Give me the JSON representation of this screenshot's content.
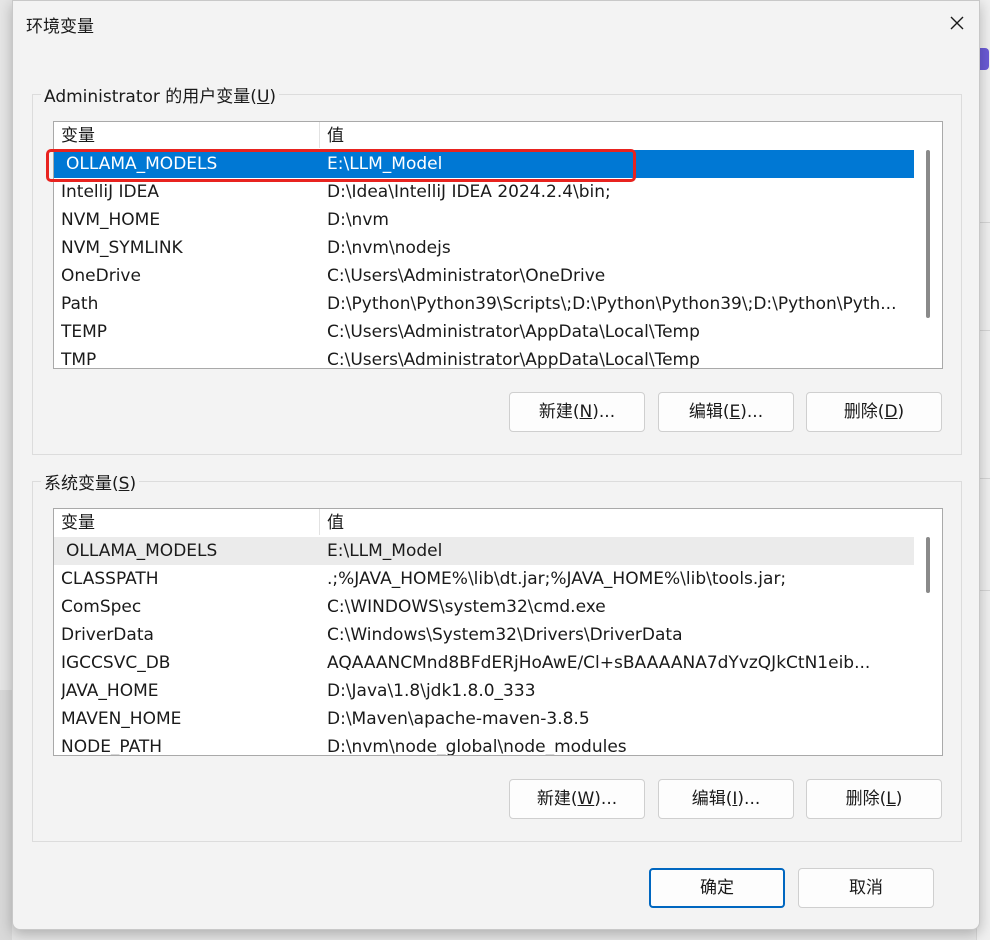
{
  "dialog": {
    "title": "环境变量",
    "close_symbol": "✕"
  },
  "user_vars": {
    "legend_prefix": "Administrator 的用户变量(",
    "legend_key": "U",
    "legend_suffix": ")",
    "columns": [
      "变量",
      "值"
    ],
    "rows": [
      {
        "name": "OLLAMA_MODELS",
        "value": "E:\\LLM_Model"
      },
      {
        "name": "IntelliJ IDEA",
        "value": "D:\\Idea\\IntelliJ IDEA 2024.2.4\\bin;"
      },
      {
        "name": "NVM_HOME",
        "value": "D:\\nvm"
      },
      {
        "name": "NVM_SYMLINK",
        "value": "D:\\nvm\\nodejs"
      },
      {
        "name": "OneDrive",
        "value": "C:\\Users\\Administrator\\OneDrive"
      },
      {
        "name": "Path",
        "value": "D:\\Python\\Python39\\Scripts\\;D:\\Python\\Python39\\;D:\\Python\\Pyth..."
      },
      {
        "name": "TEMP",
        "value": "C:\\Users\\Administrator\\AppData\\Local\\Temp"
      },
      {
        "name": "TMP",
        "value": "C:\\Users\\Administrator\\AppData\\Local\\Temp"
      }
    ],
    "selected_row": "OLLAMA_MODELS",
    "buttons": {
      "new": {
        "prefix": "新建(",
        "key": "N",
        "suffix": ")..."
      },
      "edit": {
        "prefix": "编辑(",
        "key": "E",
        "suffix": ")..."
      },
      "delete": {
        "prefix": "删除(",
        "key": "D",
        "suffix": ")"
      }
    }
  },
  "system_vars": {
    "legend_prefix": "系统变量(",
    "legend_key": "S",
    "legend_suffix": ")",
    "columns": [
      "变量",
      "值"
    ],
    "rows": [
      {
        "name": "OLLAMA_MODELS",
        "value": "E:\\LLM_Model"
      },
      {
        "name": "CLASSPATH",
        "value": ".;%JAVA_HOME%\\lib\\dt.jar;%JAVA_HOME%\\lib\\tools.jar;"
      },
      {
        "name": "ComSpec",
        "value": "C:\\WINDOWS\\system32\\cmd.exe"
      },
      {
        "name": "DriverData",
        "value": "C:\\Windows\\System32\\Drivers\\DriverData"
      },
      {
        "name": "IGCCSVC_DB",
        "value": "AQAAANCMnd8BFdERjHoAwE/Cl+sBAAAANA7dYvzQJkCtN1eib..."
      },
      {
        "name": "JAVA_HOME",
        "value": "D:\\Java\\1.8\\jdk1.8.0_333"
      },
      {
        "name": "MAVEN_HOME",
        "value": "D:\\Maven\\apache-maven-3.8.5"
      },
      {
        "name": "NODE_PATH",
        "value": "D:\\nvm\\node_global\\node_modules"
      }
    ],
    "buttons": {
      "new": {
        "prefix": "新建(",
        "key": "W",
        "suffix": ")..."
      },
      "edit": {
        "prefix": "编辑(",
        "key": "I",
        "suffix": ")..."
      },
      "delete": {
        "prefix": "删除(",
        "key": "L",
        "suffix": ")"
      }
    }
  },
  "footer": {
    "ok_label": "确定",
    "cancel_label": "取消"
  },
  "colors": {
    "selection": "#0078d4",
    "highlight_box": "#e8231f",
    "primary_border": "#0067c0"
  }
}
